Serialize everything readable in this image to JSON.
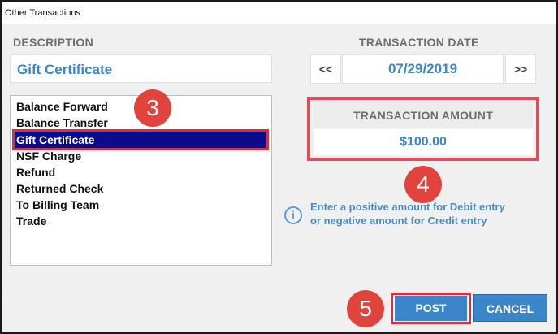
{
  "window": {
    "title": "Other Transactions"
  },
  "description": {
    "label": "DESCRIPTION",
    "value": "Gift Certificate",
    "options": [
      "Balance Forward",
      "Balance Transfer",
      "Gift Certificate",
      "NSF Charge",
      "Refund",
      "Returned Check",
      "To Billing Team",
      "Trade"
    ],
    "selected": "Gift Certificate"
  },
  "transaction_date": {
    "label": "TRANSACTION DATE",
    "prev": "<<",
    "value": "07/29/2019",
    "next": ">>"
  },
  "transaction_amount": {
    "label": "TRANSACTION AMOUNT",
    "value": "$100.00"
  },
  "info": {
    "icon": "info-icon",
    "line1": "Enter a positive amount for Debit entry",
    "line2": "or negative amount for Credit entry"
  },
  "actions": {
    "post": "POST",
    "cancel": "CANCEL"
  },
  "callouts": {
    "step3": "3",
    "step4": "4",
    "step5": "5"
  },
  "colors": {
    "accent": "#3a86c8",
    "selection": "#0b0b8c",
    "highlight": "#d8303a"
  }
}
